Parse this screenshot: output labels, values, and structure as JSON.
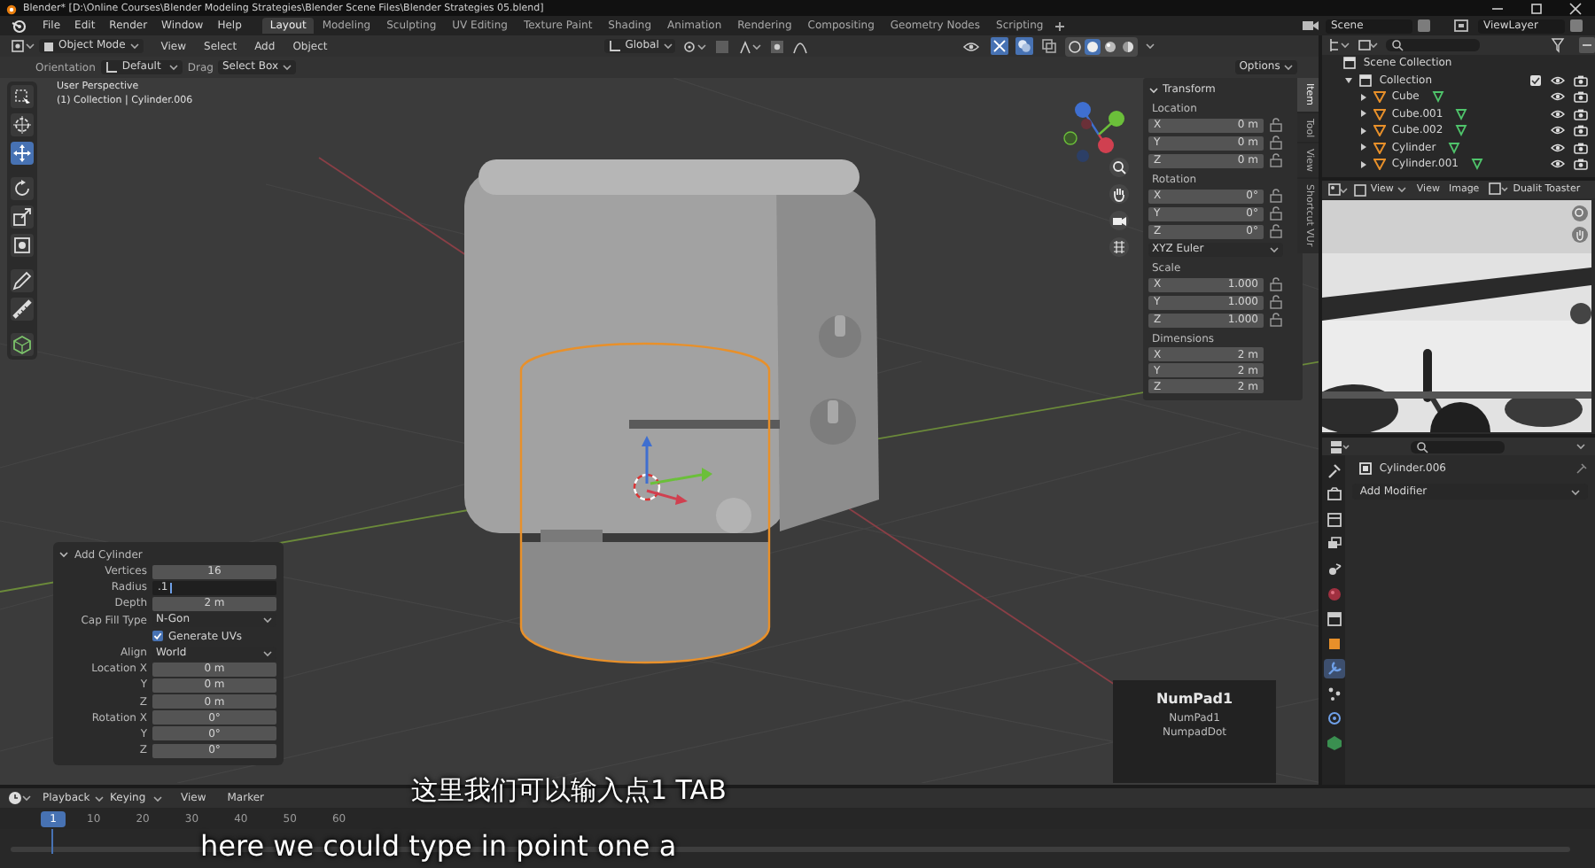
{
  "window": {
    "title": "Blender* [D:\\Online Courses\\Blender Modeling Strategies\\Blender Scene Files\\Blender Strategies 05.blend]"
  },
  "menu": [
    "File",
    "Edit",
    "Render",
    "Window",
    "Help"
  ],
  "workspaces": [
    {
      "label": "Layout",
      "selected": true
    },
    {
      "label": "Modeling",
      "selected": false
    },
    {
      "label": "Sculpting",
      "selected": false
    },
    {
      "label": "UV Editing",
      "selected": false
    },
    {
      "label": "Texture Paint",
      "selected": false
    },
    {
      "label": "Shading",
      "selected": false
    },
    {
      "label": "Animation",
      "selected": false
    },
    {
      "label": "Rendering",
      "selected": false
    },
    {
      "label": "Compositing",
      "selected": false
    },
    {
      "label": "Geometry Nodes",
      "selected": false
    },
    {
      "label": "Scripting",
      "selected": false
    }
  ],
  "scene": "Scene",
  "view_layer": "ViewLayer",
  "viewport": {
    "mode": "Object Mode",
    "menus": [
      "View",
      "Select",
      "Add",
      "Object"
    ],
    "orientation": "Global",
    "shading": [
      {
        "selected": false
      },
      {
        "selected": true
      },
      {
        "selected": false
      },
      {
        "selected": false
      }
    ],
    "tool_settings": {
      "orientation_label": "Orientation",
      "orientation": "Default",
      "drag_label": "Drag",
      "drag": "Select Box",
      "options": "Options"
    },
    "info": [
      "User Perspective",
      "(1) Collection | Cylinder.006"
    ],
    "tools": [
      {
        "kind": "select",
        "selected": false
      },
      {
        "kind": "cursor",
        "selected": false
      },
      {
        "kind": "move",
        "selected": true
      },
      {
        "kind": "rotate",
        "selected": false
      },
      {
        "kind": "scale",
        "selected": false
      },
      {
        "kind": "transform",
        "selected": false
      },
      {
        "kind": "annotate",
        "selected": false
      },
      {
        "kind": "measure",
        "selected": false
      },
      {
        "kind": "add",
        "selected": false
      }
    ]
  },
  "sidebar": {
    "tabs": [
      {
        "label": "Item",
        "selected": true
      },
      {
        "label": "Tool",
        "selected": false
      },
      {
        "label": "View",
        "selected": false
      },
      {
        "label": "Shortcut VUr",
        "selected": false
      }
    ],
    "title": "Transform",
    "groups": [
      {
        "label": "Location",
        "locks": true,
        "fields": [
          {
            "axis": "X",
            "value": "0 m"
          },
          {
            "axis": "Y",
            "value": "0 m"
          },
          {
            "axis": "Z",
            "value": "0 m"
          }
        ]
      },
      {
        "label": "Rotation",
        "locks": true,
        "fields": [
          {
            "axis": "X",
            "value": "0°"
          },
          {
            "axis": "Y",
            "value": "0°"
          },
          {
            "axis": "Z",
            "value": "0°"
          }
        ],
        "mode": "XYZ Euler"
      },
      {
        "label": "Scale",
        "locks": true,
        "fields": [
          {
            "axis": "X",
            "value": "1.000"
          },
          {
            "axis": "Y",
            "value": "1.000"
          },
          {
            "axis": "Z",
            "value": "1.000"
          }
        ]
      },
      {
        "label": "Dimensions",
        "locks": false,
        "fields": [
          {
            "axis": "X",
            "value": "2 m"
          },
          {
            "axis": "Y",
            "value": "2 m"
          },
          {
            "axis": "Z",
            "value": "2 m"
          }
        ]
      }
    ]
  },
  "operator_panel": {
    "title": "Add Cylinder",
    "rows": [
      {
        "kind": "number",
        "label": "Vertices",
        "value": "16"
      },
      {
        "kind": "editing",
        "label": "Radius",
        "value": ".1"
      },
      {
        "kind": "number",
        "label": "Depth",
        "value": "2 m"
      },
      {
        "kind": "dropdown",
        "label": "Cap Fill Type",
        "value": "N-Gon"
      },
      {
        "kind": "checkbox",
        "label": "Generate UVs",
        "checked": true
      },
      {
        "kind": "dropdown",
        "label": "Align",
        "value": "World"
      },
      {
        "kind": "number",
        "label": "Location X",
        "value": "0 m"
      },
      {
        "kind": "number",
        "label": "Y",
        "value": "0 m"
      },
      {
        "kind": "number",
        "label": "Z",
        "value": "0 m"
      },
      {
        "kind": "number",
        "label": "Rotation X",
        "value": "0°"
      },
      {
        "kind": "number",
        "label": "Y",
        "value": "0°"
      },
      {
        "kind": "number",
        "label": "Z",
        "value": "0°"
      }
    ]
  },
  "key_overlay": {
    "title": "NumPad1",
    "lines": [
      "NumPad1",
      "NumpadDot"
    ]
  },
  "outliner": {
    "root": "Scene Collection",
    "items": [
      {
        "label": "Collection",
        "expanded": true,
        "children": [
          {
            "label": "Cube",
            "expanded": false
          },
          {
            "label": "Cube.001",
            "expanded": false
          },
          {
            "label": "Cube.002",
            "expanded": false
          },
          {
            "label": "Cylinder",
            "expanded": false
          },
          {
            "label": "Cylinder.001",
            "expanded": false
          }
        ]
      }
    ]
  },
  "image_editor": {
    "menus": [
      "View",
      "View",
      "Image"
    ],
    "image_name": "Dualit Toaster"
  },
  "properties": {
    "object": "Cylinder.006",
    "add_modifier": "Add Modifier",
    "tabs": [
      {
        "kind": "tool",
        "selected": false
      },
      {
        "kind": "render",
        "selected": false
      },
      {
        "kind": "output",
        "selected": false
      },
      {
        "kind": "view-layer",
        "selected": false
      },
      {
        "kind": "scene",
        "selected": false
      },
      {
        "kind": "world",
        "selected": false
      },
      {
        "kind": "collection",
        "selected": false
      },
      {
        "kind": "object",
        "selected": false
      },
      {
        "kind": "modifier",
        "selected": true
      },
      {
        "kind": "particles",
        "selected": false
      },
      {
        "kind": "physics",
        "selected": false
      },
      {
        "kind": "data",
        "selected": false
      }
    ]
  },
  "timeline": {
    "menus": [
      "Playback",
      "Keying",
      "View",
      "Marker"
    ],
    "current_frame": "1",
    "frames": [
      "10",
      "20",
      "30",
      "40",
      "50",
      "60"
    ]
  },
  "subtitles": [
    "这里我们可以输入点1 TAB",
    "here we could type in point one a"
  ]
}
